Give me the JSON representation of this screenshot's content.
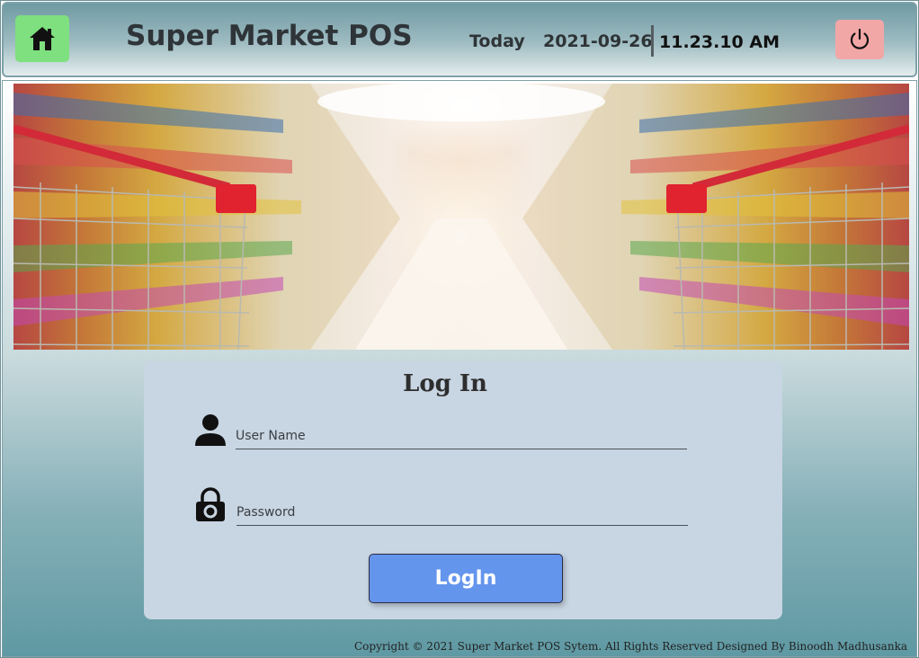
{
  "header": {
    "title": "Super Market POS",
    "today_label": "Today",
    "date": "2021-09-26",
    "time": "11.23.10 AM",
    "home_icon": "home-icon",
    "power_icon": "power-icon",
    "home_color": "#7ee07e",
    "power_color": "#f2a7a7"
  },
  "banner": {
    "description_icon": "supermarket-aisle-shopping-carts-image"
  },
  "login": {
    "title": "Log In",
    "username_placeholder": "User Name",
    "password_placeholder": "Password",
    "button_label": "LogIn",
    "button_color": "#6495ed",
    "user_icon": "user-icon",
    "lock_icon": "lock-icon"
  },
  "footer": {
    "copyright": "Copyright © 2021 Super Market POS Sytem. All Rights Reserved Designed By Binoodh Madhusanka"
  }
}
